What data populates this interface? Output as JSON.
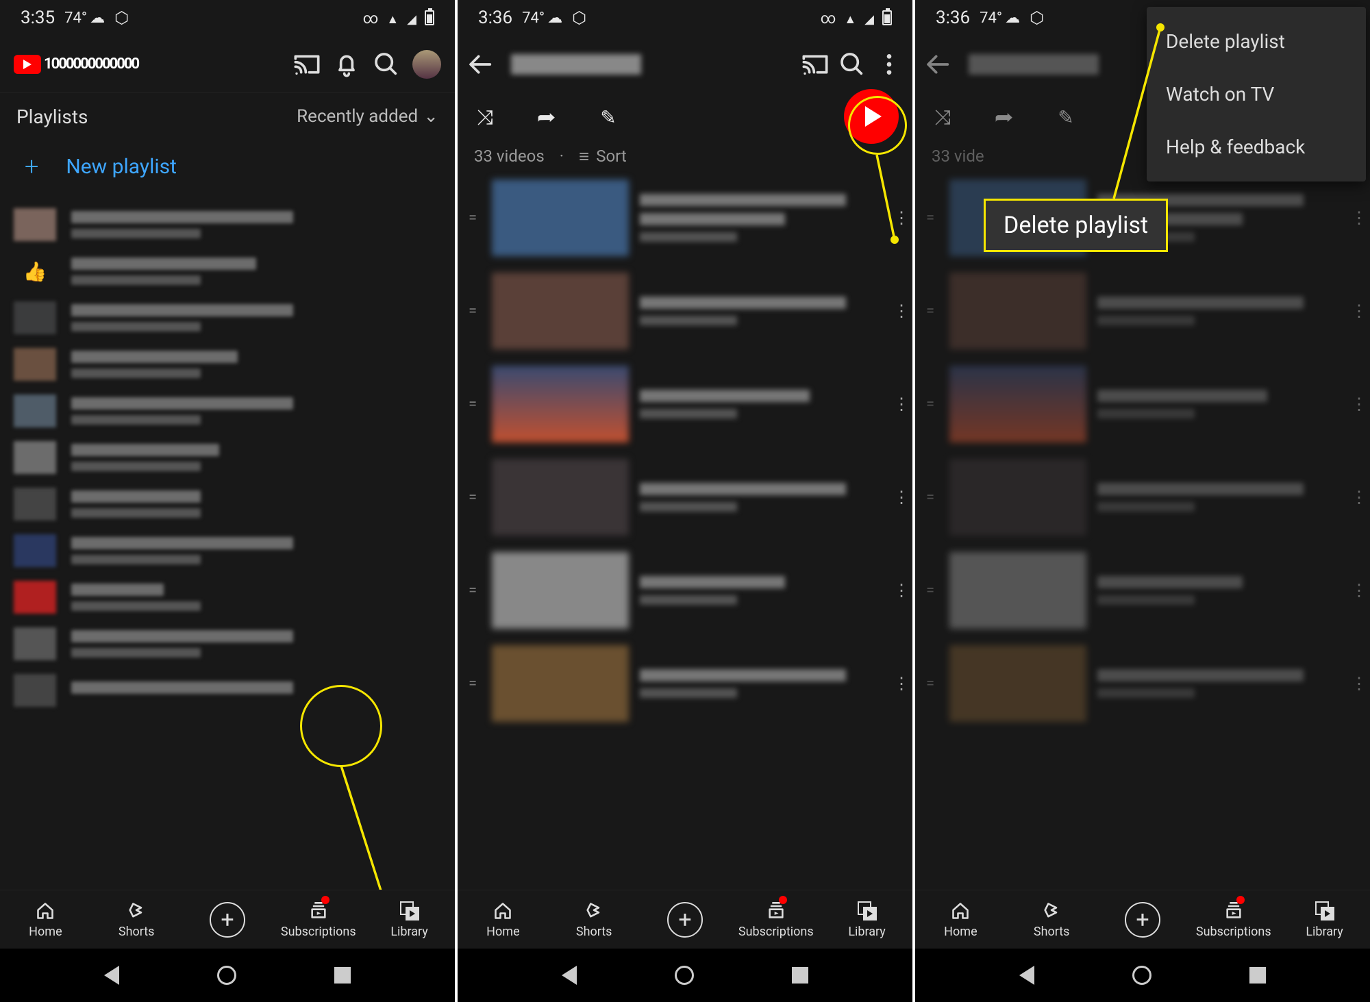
{
  "screens": {
    "s1": {
      "status_time": "3:35",
      "status_temp": "74°",
      "playlists_title": "Playlists",
      "sort_label": "Recently added",
      "new_playlist": "New playlist"
    },
    "s2": {
      "status_time": "3:36",
      "video_count": "33 videos",
      "dot": "·",
      "sort": "Sort"
    },
    "s3": {
      "status_time": "3:36",
      "video_count_partial": "33 vide",
      "menu": {
        "delete": "Delete playlist",
        "watch": "Watch on TV",
        "help": "Help & feedback"
      },
      "callout": "Delete playlist"
    }
  },
  "bottomnav": {
    "home": "Home",
    "shorts": "Shorts",
    "subs": "Subscriptions",
    "library": "Library"
  },
  "yt_word": "1000000000000"
}
